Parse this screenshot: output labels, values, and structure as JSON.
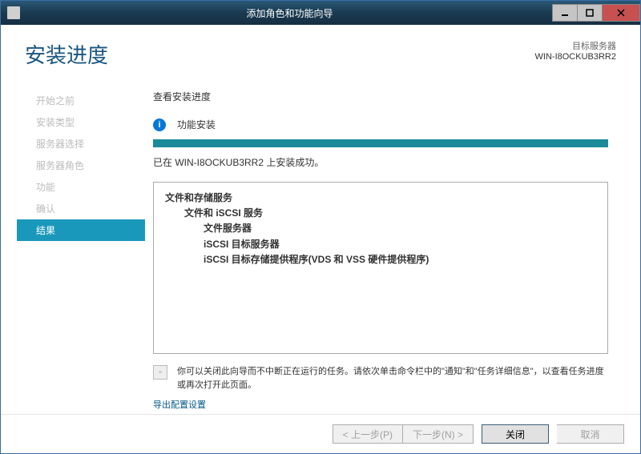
{
  "window": {
    "title": "添加角色和功能向导"
  },
  "header": {
    "page_title": "安装进度",
    "target_label": "目标服务器",
    "target_value": "WIN-I8OCKUB3RR2"
  },
  "sidebar": {
    "items": [
      {
        "label": "开始之前"
      },
      {
        "label": "安装类型"
      },
      {
        "label": "服务器选择"
      },
      {
        "label": "服务器角色"
      },
      {
        "label": "功能"
      },
      {
        "label": "确认"
      },
      {
        "label": "结果"
      }
    ]
  },
  "main": {
    "section_label": "查看安装进度",
    "feature_install": "功能安装",
    "status": "已在 WIN-I8OCKUB3RR2 上安装成功。",
    "results": {
      "l0": "文件和存储服务",
      "l1": "文件和 iSCSI 服务",
      "l2a": "文件服务器",
      "l2b": "iSCSI 目标服务器",
      "l2c": "iSCSI 目标存储提供程序(VDS 和 VSS 硬件提供程序)"
    },
    "hint": "你可以关闭此向导而不中断正在运行的任务。请依次单击命令栏中的\"通知\"和\"任务详细信息\"，以查看任务进度或再次打开此页面。",
    "export_link": "导出配置设置"
  },
  "buttons": {
    "prev": "< 上一步(P)",
    "next": "下一步(N) >",
    "close": "关闭",
    "cancel": "取消"
  }
}
